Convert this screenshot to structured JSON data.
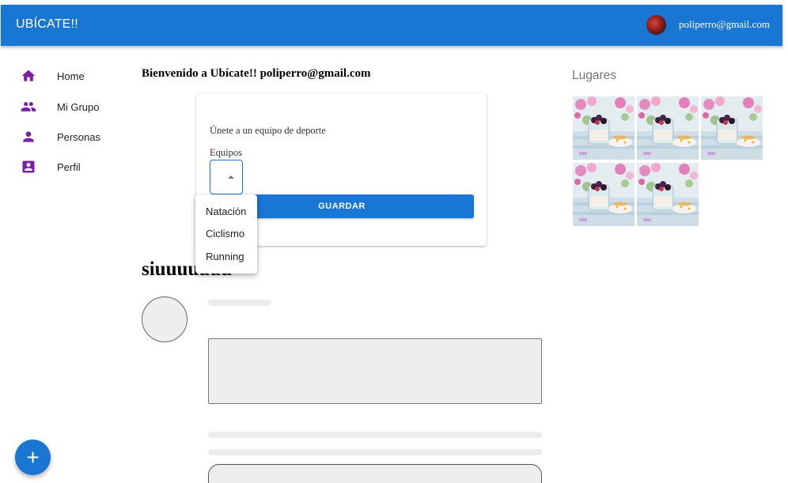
{
  "appbar": {
    "title": "UBÍCATE!!",
    "user_email": "poliperro@gmail.com"
  },
  "sidebar": {
    "items": [
      {
        "label": "Home",
        "icon": "home-icon"
      },
      {
        "label": "Mi Grupo",
        "icon": "group-icon"
      },
      {
        "label": "Personas",
        "icon": "person-icon"
      },
      {
        "label": "Perfil",
        "icon": "profile-card-icon"
      }
    ],
    "icon_color": "#7b1fa2"
  },
  "main": {
    "welcome": "Bienvenido a Ubícate!! poliperro@gmail.com",
    "card": {
      "heading": "Únete a un equipo de deporte",
      "select_label": "Equipos",
      "select_value": "",
      "save_label": "GUARDAR"
    },
    "dropdown": {
      "options": [
        "Natación",
        "Ciclismo",
        "Running"
      ]
    },
    "big_title": "siuuuuuuu"
  },
  "places": {
    "title": "Lugares",
    "image_count": 5
  },
  "colors": {
    "primary": "#1976d2",
    "accent_icon": "#7b1fa2",
    "skeleton": "#eeeeee"
  }
}
